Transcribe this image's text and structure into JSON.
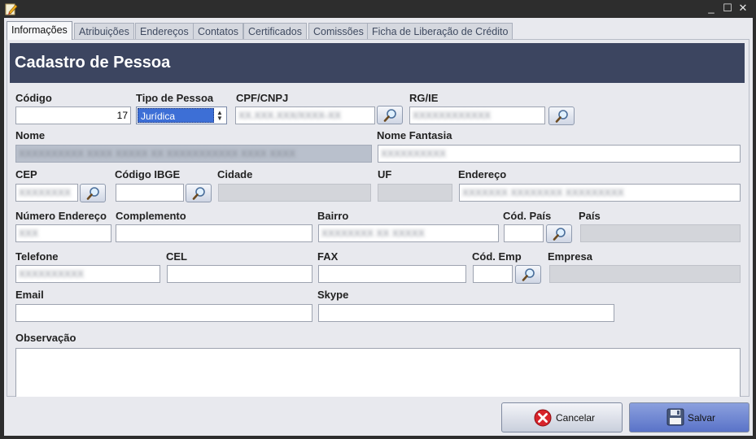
{
  "window": {
    "app_icon": "pencil-icon",
    "controls": {
      "minimize": "_",
      "maximize": "☐",
      "close": "✕"
    }
  },
  "tabs": [
    {
      "label": "Informações",
      "active": true
    },
    {
      "label": "Atribuições"
    },
    {
      "label": "Endereços"
    },
    {
      "label": "Contatos"
    },
    {
      "label": "Certificados"
    },
    {
      "label": "Comissões"
    },
    {
      "label": "Ficha de Liberação de Crédito"
    }
  ],
  "header": {
    "title": "Cadastro de Pessoa"
  },
  "labels": {
    "codigo": "Código",
    "tipo_pessoa": "Tipo de Pessoa",
    "cpf_cnpj": "CPF/CNPJ",
    "rg_ie": "RG/IE",
    "nome": "Nome",
    "nome_fantasia": "Nome Fantasia",
    "cep": "CEP",
    "codigo_ibge": "Código IBGE",
    "cidade": "Cidade",
    "uf": "UF",
    "endereco": "Endereço",
    "numero_endereco": "Número Endereço",
    "complemento": "Complemento",
    "bairro": "Bairro",
    "cod_pais": "Cód. País",
    "pais": "País",
    "telefone": "Telefone",
    "cel": "CEL",
    "fax": "FAX",
    "cod_emp": "Cód. Emp",
    "empresa": "Empresa",
    "email": "Email",
    "skype": "Skype",
    "observacao": "Observação"
  },
  "values": {
    "codigo": "17",
    "tipo_pessoa": "Jurídica",
    "cpf_cnpj": "XX.XXX.XXX/XXXX-XX",
    "rg_ie": "XXXXXXXXXXXX",
    "nome": "XXXXXXXXXX XXXX XXXXX XX XXXXXXXXXXX XXXX XXXX",
    "nome_fantasia": "XXXXXXXXXX",
    "cep": "XXXXXXXX",
    "endereco": "XXXXXXX XXXXXXXX XXXXXXXXX",
    "numero_endereco": "XXX",
    "bairro": "XXXXXXXX XX XXXXX",
    "telefone": "XXXXXXXXXX"
  },
  "buttons": {
    "cancel": "Cancelar",
    "save": "Salvar"
  },
  "colors": {
    "header_bg": "#3c4560",
    "selection": "#3d6fd6",
    "cancel_icon": "#d8232a",
    "save_button": "#6b82d0"
  }
}
